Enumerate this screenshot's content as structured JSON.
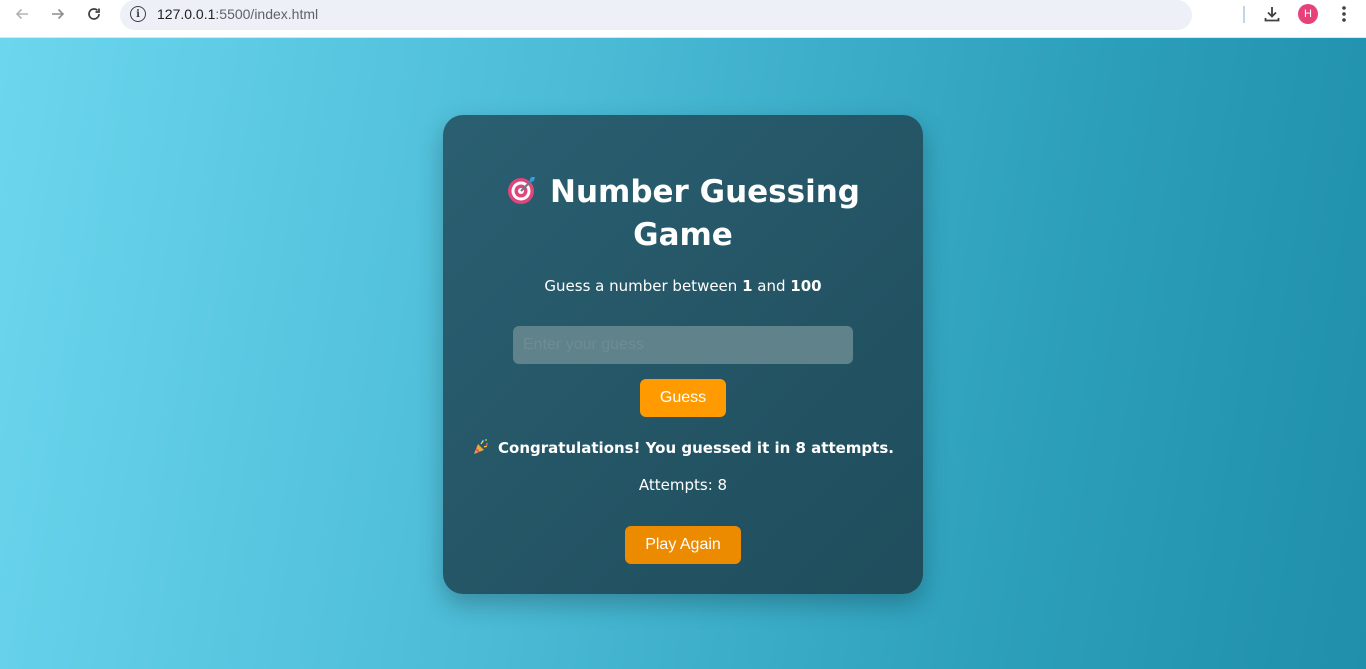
{
  "browser": {
    "url_host": "127.0.0.1",
    "url_path": ":5500/index.html",
    "avatar_letter": "H"
  },
  "game": {
    "title_line1": "Number Guessing",
    "title_line2": "Game",
    "subtitle_prefix": "Guess a number between ",
    "min": "1",
    "subtitle_mid": " and ",
    "max": "100",
    "input_placeholder": "Enter your guess",
    "guess_label": "Guess",
    "message": "Congratulations! You guessed it in 8 attempts.",
    "attempts_text": "Attempts: 8",
    "play_again_label": "Play Again"
  },
  "colors": {
    "card_bg": "#245a6a",
    "button_orange": "#ff9b00",
    "play_again_orange": "#ec8a00",
    "avatar": "#e8407a"
  },
  "icons": {
    "title": "target-dart-icon",
    "message": "party-popper-icon"
  }
}
